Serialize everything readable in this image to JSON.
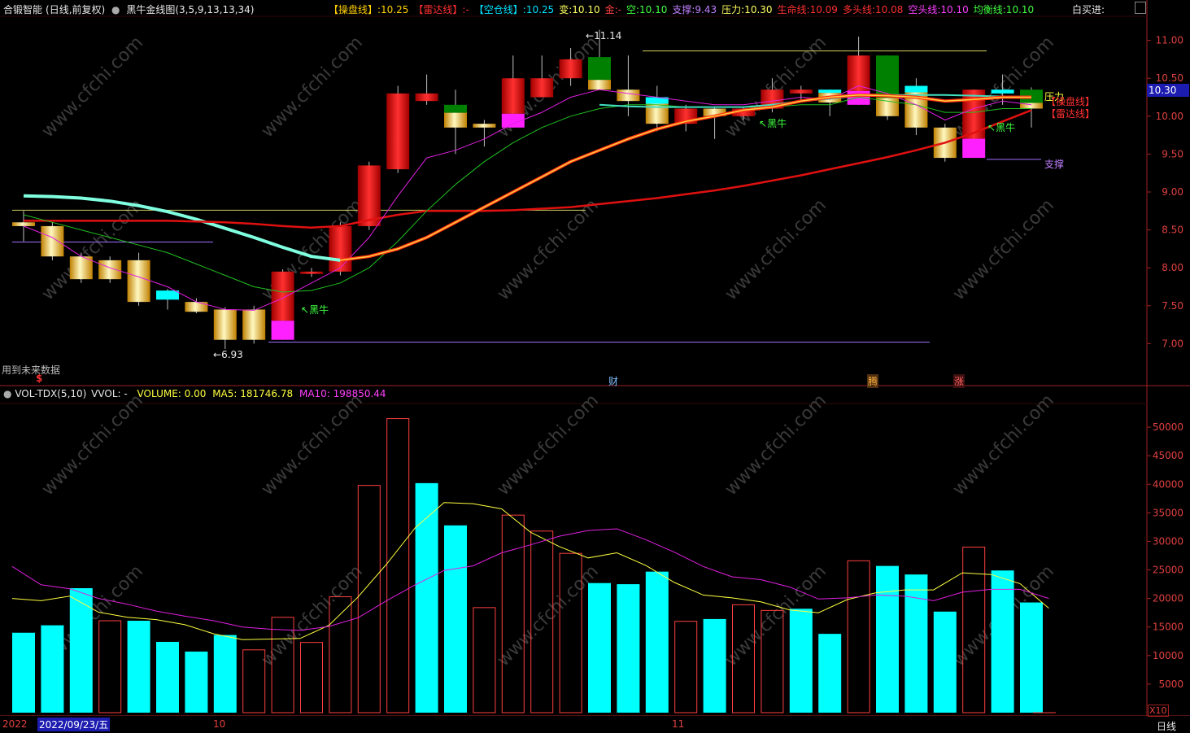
{
  "header": {
    "stock": "合锻智能",
    "period": "(日线,前复权)",
    "indicator": "黑牛金线图(3,5,9,13,13,34)",
    "items": [
      {
        "label": "【操盘线】:",
        "value": "10.25",
        "color": "#ffd000"
      },
      {
        "label": "【雷达线】:",
        "value": "-",
        "color": "#ff3030"
      },
      {
        "label": "【空仓线】:",
        "value": "10.25",
        "color": "#00e0ff"
      },
      {
        "label": "变:",
        "value": "10.10",
        "color": "#ffff60"
      },
      {
        "label": "金:",
        "value": "-",
        "color": "#ff4040"
      },
      {
        "label": "空:",
        "value": "10.10",
        "color": "#40ff40"
      },
      {
        "label": "支撑:",
        "value": "9.43",
        "color": "#c080ff"
      },
      {
        "label": "压力:",
        "value": "10.30",
        "color": "#ffff60"
      },
      {
        "label": "生命线:",
        "value": "10.09",
        "color": "#ff3030"
      },
      {
        "label": "多头线:",
        "value": "10.08",
        "color": "#ff3030"
      },
      {
        "label": "空头线:",
        "value": "10.10",
        "color": "#ff40ff"
      },
      {
        "label": "均衡线:",
        "value": "10.10",
        "color": "#40ff40"
      }
    ],
    "right_label": "白买进:"
  },
  "future_data_label": "用到未来数据",
  "vol_header": {
    "name": "VOL-TDX(5,10)",
    "vvol": "VVOL: -",
    "volume": "VOLUME: 0.00",
    "ma5": "MA5: 181746.78",
    "ma10": "MA10: 198850.44"
  },
  "price_axis": {
    "ticks": [
      "11.00",
      "10.50",
      "10.00",
      "9.50",
      "9.00",
      "8.50",
      "8.00",
      "7.50",
      "7.00"
    ],
    "current": "10.30"
  },
  "volume_axis": {
    "ticks": [
      "50000",
      "45000",
      "40000",
      "35000",
      "30000",
      "25000",
      "20000",
      "15000",
      "10000",
      "5000"
    ],
    "unit": "X10"
  },
  "annotations": {
    "high": "11.14",
    "low": "6.93",
    "signal_label": "黑牛",
    "support_label": "支撑",
    "pressure_label": "压力",
    "caopan_label": "【操盘线】",
    "leida_label": "【雷达线】",
    "event_cai": "财",
    "event_teng": "腾",
    "event_zhang": "涨",
    "event_dollar": "$"
  },
  "bottom_axis": {
    "date_left": "2022",
    "date_cursor": "2022/09/23/五",
    "month_10": "10",
    "month_11": "11",
    "period_btn": "日线"
  },
  "colors": {
    "up": "#ff2020",
    "down_cyan": "#00ffff",
    "gold": "#ffe040",
    "magenta": "#ff20ff",
    "green": "#008000",
    "axis": "#a02020"
  },
  "chart_data": {
    "type": "candlestick+volume",
    "candles": [
      {
        "o": 8.6,
        "c": 8.55,
        "h": 8.75,
        "l": 8.35,
        "k": "gold"
      },
      {
        "o": 8.55,
        "c": 8.15,
        "h": 8.6,
        "l": 8.1,
        "k": "gold"
      },
      {
        "o": 8.15,
        "c": 7.85,
        "h": 8.2,
        "l": 7.8,
        "k": "gold"
      },
      {
        "o": 8.1,
        "c": 7.85,
        "h": 8.15,
        "l": 7.8,
        "k": "gold"
      },
      {
        "o": 8.1,
        "c": 7.55,
        "h": 8.2,
        "l": 7.5,
        "k": "gold"
      },
      {
        "o": 7.7,
        "c": 7.58,
        "h": 7.72,
        "l": 7.45,
        "k": "cyan"
      },
      {
        "o": 7.55,
        "c": 7.42,
        "h": 7.6,
        "l": 7.4,
        "k": "gold"
      },
      {
        "o": 7.45,
        "c": 7.05,
        "h": 7.48,
        "l": 6.93,
        "k": "gold"
      },
      {
        "o": 7.45,
        "c": 7.05,
        "h": 7.5,
        "l": 7.0,
        "k": "gold"
      },
      {
        "o": 7.05,
        "c": 7.95,
        "h": 7.98,
        "l": 7.05,
        "k": "up_mag"
      },
      {
        "o": 7.95,
        "c": 7.92,
        "h": 8.0,
        "l": 7.88,
        "k": "up"
      },
      {
        "o": 7.95,
        "c": 8.55,
        "h": 8.6,
        "l": 7.9,
        "k": "up"
      },
      {
        "o": 8.55,
        "c": 9.35,
        "h": 9.4,
        "l": 8.5,
        "k": "up"
      },
      {
        "o": 9.3,
        "c": 10.3,
        "h": 10.4,
        "l": 9.25,
        "k": "up"
      },
      {
        "o": 10.3,
        "c": 10.2,
        "h": 10.55,
        "l": 10.15,
        "k": "up"
      },
      {
        "o": 10.15,
        "c": 9.85,
        "h": 10.35,
        "l": 9.5,
        "k": "gold_green"
      },
      {
        "o": 9.9,
        "c": 9.85,
        "h": 9.95,
        "l": 9.6,
        "k": "gold"
      },
      {
        "o": 9.85,
        "c": 10.5,
        "h": 10.8,
        "l": 9.85,
        "k": "up_mag"
      },
      {
        "o": 10.25,
        "c": 10.5,
        "h": 10.8,
        "l": 10.25,
        "k": "up"
      },
      {
        "o": 10.5,
        "c": 10.75,
        "h": 10.9,
        "l": 10.4,
        "k": "up"
      },
      {
        "o": 10.78,
        "c": 10.35,
        "h": 11.14,
        "l": 10.35,
        "k": "green_gold"
      },
      {
        "o": 10.35,
        "c": 10.2,
        "h": 10.8,
        "l": 10.0,
        "k": "gold"
      },
      {
        "o": 10.25,
        "c": 9.9,
        "h": 10.4,
        "l": 9.8,
        "k": "cyan_gold"
      },
      {
        "o": 9.9,
        "c": 10.1,
        "h": 10.15,
        "l": 9.8,
        "k": "up"
      },
      {
        "o": 10.1,
        "c": 10.0,
        "h": 10.12,
        "l": 9.7,
        "k": "gold"
      },
      {
        "o": 10.0,
        "c": 10.1,
        "h": 10.12,
        "l": 9.95,
        "k": "up"
      },
      {
        "o": 10.1,
        "c": 10.35,
        "h": 10.5,
        "l": 10.05,
        "k": "up"
      },
      {
        "o": 10.35,
        "c": 10.3,
        "h": 10.4,
        "l": 10.2,
        "k": "up"
      },
      {
        "o": 10.35,
        "c": 10.18,
        "h": 10.35,
        "l": 10.0,
        "k": "gold_cyan"
      },
      {
        "o": 10.15,
        "c": 10.8,
        "h": 11.05,
        "l": 10.15,
        "k": "up_mag"
      },
      {
        "o": 10.8,
        "c": 10.0,
        "h": 10.8,
        "l": 9.95,
        "k": "green_gold"
      },
      {
        "o": 10.4,
        "c": 9.85,
        "h": 10.5,
        "l": 9.75,
        "k": "cyan_gold"
      },
      {
        "o": 9.85,
        "c": 9.45,
        "h": 9.9,
        "l": 9.4,
        "k": "gold"
      },
      {
        "o": 9.45,
        "c": 10.35,
        "h": 10.35,
        "l": 9.45,
        "k": "up_mag"
      },
      {
        "o": 10.35,
        "c": 10.3,
        "h": 10.55,
        "l": 10.15,
        "k": "cyan"
      },
      {
        "o": 10.35,
        "c": 10.1,
        "h": 10.38,
        "l": 9.85,
        "k": "green_gold"
      }
    ],
    "volume": [
      {
        "v": 14000,
        "k": "cyan"
      },
      {
        "v": 15300,
        "k": "cyan"
      },
      {
        "v": 21800,
        "k": "cyan"
      },
      {
        "v": 16100,
        "k": "hollow"
      },
      {
        "v": 16100,
        "k": "cyan"
      },
      {
        "v": 12400,
        "k": "cyan"
      },
      {
        "v": 10700,
        "k": "cyan"
      },
      {
        "v": 13600,
        "k": "cyan"
      },
      {
        "v": 11000,
        "k": "hollow"
      },
      {
        "v": 16700,
        "k": "hollow"
      },
      {
        "v": 12300,
        "k": "hollow"
      },
      {
        "v": 20300,
        "k": "hollow"
      },
      {
        "v": 39800,
        "k": "hollow"
      },
      {
        "v": 51500,
        "k": "hollow"
      },
      {
        "v": 40200,
        "k": "cyan"
      },
      {
        "v": 32800,
        "k": "cyan"
      },
      {
        "v": 18400,
        "k": "hollow"
      },
      {
        "v": 34600,
        "k": "hollow"
      },
      {
        "v": 31800,
        "k": "hollow"
      },
      {
        "v": 27900,
        "k": "hollow"
      },
      {
        "v": 22700,
        "k": "cyan"
      },
      {
        "v": 22500,
        "k": "cyan"
      },
      {
        "v": 24700,
        "k": "cyan"
      },
      {
        "v": 16000,
        "k": "hollow"
      },
      {
        "v": 16400,
        "k": "cyan"
      },
      {
        "v": 18900,
        "k": "hollow"
      },
      {
        "v": 17900,
        "k": "hollow"
      },
      {
        "v": 18200,
        "k": "cyan"
      },
      {
        "v": 13800,
        "k": "cyan"
      },
      {
        "v": 26600,
        "k": "hollow"
      },
      {
        "v": 25700,
        "k": "cyan"
      },
      {
        "v": 24200,
        "k": "cyan"
      },
      {
        "v": 17700,
        "k": "cyan"
      },
      {
        "v": 29000,
        "k": "hollow"
      },
      {
        "v": 24900,
        "k": "cyan"
      },
      {
        "v": 19300,
        "k": "cyan"
      }
    ],
    "ma5_vol": [
      20000,
      19600,
      20400,
      17600,
      16700,
      16300,
      15400,
      13800,
      12800,
      12900,
      13000,
      15300,
      20200,
      26000,
      32400,
      36800,
      36600,
      35700,
      31600,
      29100,
      27100,
      28000,
      25800,
      22800,
      20600,
      20100,
      19400,
      18000,
      17500,
      19800,
      21000,
      21500,
      21500,
      24500,
      24200,
      22600,
      18300
    ],
    "ma10_vol": [
      25600,
      22400,
      21700,
      20000,
      19000,
      17800,
      16900,
      16100,
      15000,
      14600,
      14400,
      15100,
      16600,
      19600,
      22400,
      24900,
      25700,
      28000,
      29400,
      30900,
      31900,
      32200,
      30300,
      28100,
      25600,
      23800,
      23300,
      22000,
      19900,
      20100,
      20600,
      20400,
      19600,
      21100,
      21600,
      21600,
      20000
    ],
    "ma_magenta": [
      8.55,
      8.4,
      8.15,
      8.0,
      7.88,
      7.75,
      7.55,
      7.45,
      7.44,
      7.6,
      7.8,
      8.0,
      8.4,
      8.95,
      9.45,
      9.55,
      9.7,
      9.9,
      10.05,
      10.25,
      10.35,
      10.3,
      10.25,
      10.2,
      10.15,
      10.15,
      10.2,
      10.25,
      10.22,
      10.4,
      10.3,
      10.15,
      9.95,
      10.1,
      10.2,
      10.15
    ],
    "ma_green": [
      8.7,
      8.6,
      8.5,
      8.4,
      8.3,
      8.2,
      8.05,
      7.9,
      7.75,
      7.68,
      7.7,
      7.8,
      8.0,
      8.35,
      8.75,
      9.1,
      9.4,
      9.65,
      9.85,
      10.0,
      10.1,
      10.15,
      10.15,
      10.12,
      10.12,
      10.12,
      10.12,
      10.15,
      10.15,
      10.25,
      10.2,
      10.15,
      10.05,
      10.05,
      10.1,
      10.1
    ],
    "ma_red_long": [
      8.62,
      8.62,
      8.62,
      8.62,
      8.62,
      8.62,
      8.61,
      8.6,
      8.58,
      8.55,
      8.53,
      8.55,
      8.63,
      8.7,
      8.75,
      8.75,
      8.75,
      8.76,
      8.78,
      8.8,
      8.84,
      8.88,
      8.92,
      8.97,
      9.02,
      9.08,
      9.15,
      9.22,
      9.3,
      9.38,
      9.46,
      9.55,
      9.65,
      9.78,
      9.93,
      10.08
    ],
    "ma_thick_double": [
      null,
      null,
      null,
      null,
      null,
      null,
      null,
      null,
      null,
      null,
      null,
      8.1,
      8.15,
      8.25,
      8.4,
      8.6,
      8.8,
      9.0,
      9.2,
      9.4,
      9.55,
      9.7,
      9.83,
      9.93,
      10.0,
      10.08,
      10.12,
      10.2,
      10.25,
      10.28,
      10.27,
      10.25,
      10.2,
      10.22,
      10.25,
      10.25
    ],
    "ma_cyan_thick": [
      8.95,
      8.94,
      8.92,
      8.88,
      8.82,
      8.74,
      8.64,
      8.52,
      8.4,
      8.27,
      8.15,
      8.1
    ],
    "ma_teal": [
      null,
      null,
      null,
      null,
      null,
      null,
      null,
      null,
      null,
      null,
      null,
      null,
      null,
      null,
      null,
      null,
      null,
      null,
      null,
      null,
      10.15,
      10.13,
      10.12,
      10.12,
      10.12,
      10.12,
      10.15,
      10.2,
      10.23,
      10.27,
      10.28,
      10.28,
      10.28,
      10.27,
      10.26,
      10.25
    ],
    "ylim_price": [
      6.65,
      11.35
    ],
    "ylim_volume": [
      0,
      55000
    ]
  }
}
